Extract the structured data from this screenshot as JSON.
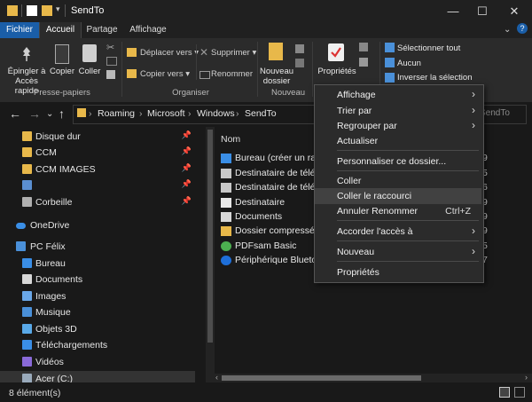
{
  "window": {
    "title": "SendTo"
  },
  "ribbon_tabs": [
    "Fichier",
    "Accueil",
    "Partage",
    "Affichage"
  ],
  "ribbon": {
    "pin_label": "Épingler à\nAccès rapide",
    "copy_label": "Copier",
    "paste_label": "Coller",
    "group_clipboard": "Presse-papiers",
    "move_label": "Déplacer vers",
    "copyto_label": "Copier vers",
    "delete_label": "Supprimer",
    "rename_label": "Renommer",
    "group_organize": "Organiser",
    "newfolder_label": "Nouveau\ndossier",
    "group_new": "Nouveau",
    "props_label": "Propriétés",
    "selectall_label": "Sélectionner tout",
    "none_label": "Aucun",
    "invert_label": "Inverser la sélection"
  },
  "address": {
    "crumbs": [
      "Roaming",
      "Microsoft",
      "Windows",
      "SendTo"
    ],
    "search_placeholder": "SendTo"
  },
  "nav": {
    "quick": [
      {
        "label": "Disque dur",
        "pinned": true
      },
      {
        "label": "CCM",
        "pinned": true
      },
      {
        "label": "CCM IMAGES",
        "pinned": true
      },
      {
        "label": "",
        "pinned": true
      },
      {
        "label": "Corbeille",
        "pinned": true
      }
    ],
    "onedrive": "OneDrive",
    "pc": "PC Félix",
    "pc_items": [
      "Bureau",
      "Documents",
      "Images",
      "Musique",
      "Objets 3D",
      "Téléchargements",
      "Vidéos",
      "Acer (C:)"
    ]
  },
  "content": {
    "column_name": "Nom",
    "files": [
      {
        "name": "Bureau (créer un raccourci)",
        "date_suffix": "9"
      },
      {
        "name": "Destinataire de télécopie",
        "date_suffix": "5"
      },
      {
        "name": "Destinataire de télécopie",
        "date_suffix": "6"
      },
      {
        "name": "Destinataire",
        "date_suffix": "9"
      },
      {
        "name": "Documents",
        "date_suffix": "9"
      },
      {
        "name": "Dossier compressé",
        "date_suffix": "9"
      },
      {
        "name": "PDFsam Basic",
        "date_suffix": "5"
      },
      {
        "name": "Périphérique Bluetooth",
        "date_suffix": "7"
      }
    ]
  },
  "context_menu": [
    {
      "label": "Affichage",
      "submenu": true
    },
    {
      "label": "Trier par",
      "submenu": true
    },
    {
      "label": "Regrouper par",
      "submenu": true
    },
    {
      "label": "Actualiser"
    },
    {
      "label": "Personnaliser ce dossier..."
    },
    {
      "label": "Coller"
    },
    {
      "label": "Coller le raccourci",
      "highlighted": true
    },
    {
      "label": "Annuler Renommer",
      "shortcut": "Ctrl+Z"
    },
    {
      "label": "Accorder l'accès à",
      "submenu": true
    },
    {
      "label": "Nouveau",
      "submenu": true
    },
    {
      "label": "Propriétés"
    }
  ],
  "status": {
    "count": "8 élément(s)"
  },
  "colors": {
    "accent": "#1a5ea8",
    "folder": "#e8b84a",
    "bg": "#191919",
    "ribbon": "#2b2b2b"
  }
}
